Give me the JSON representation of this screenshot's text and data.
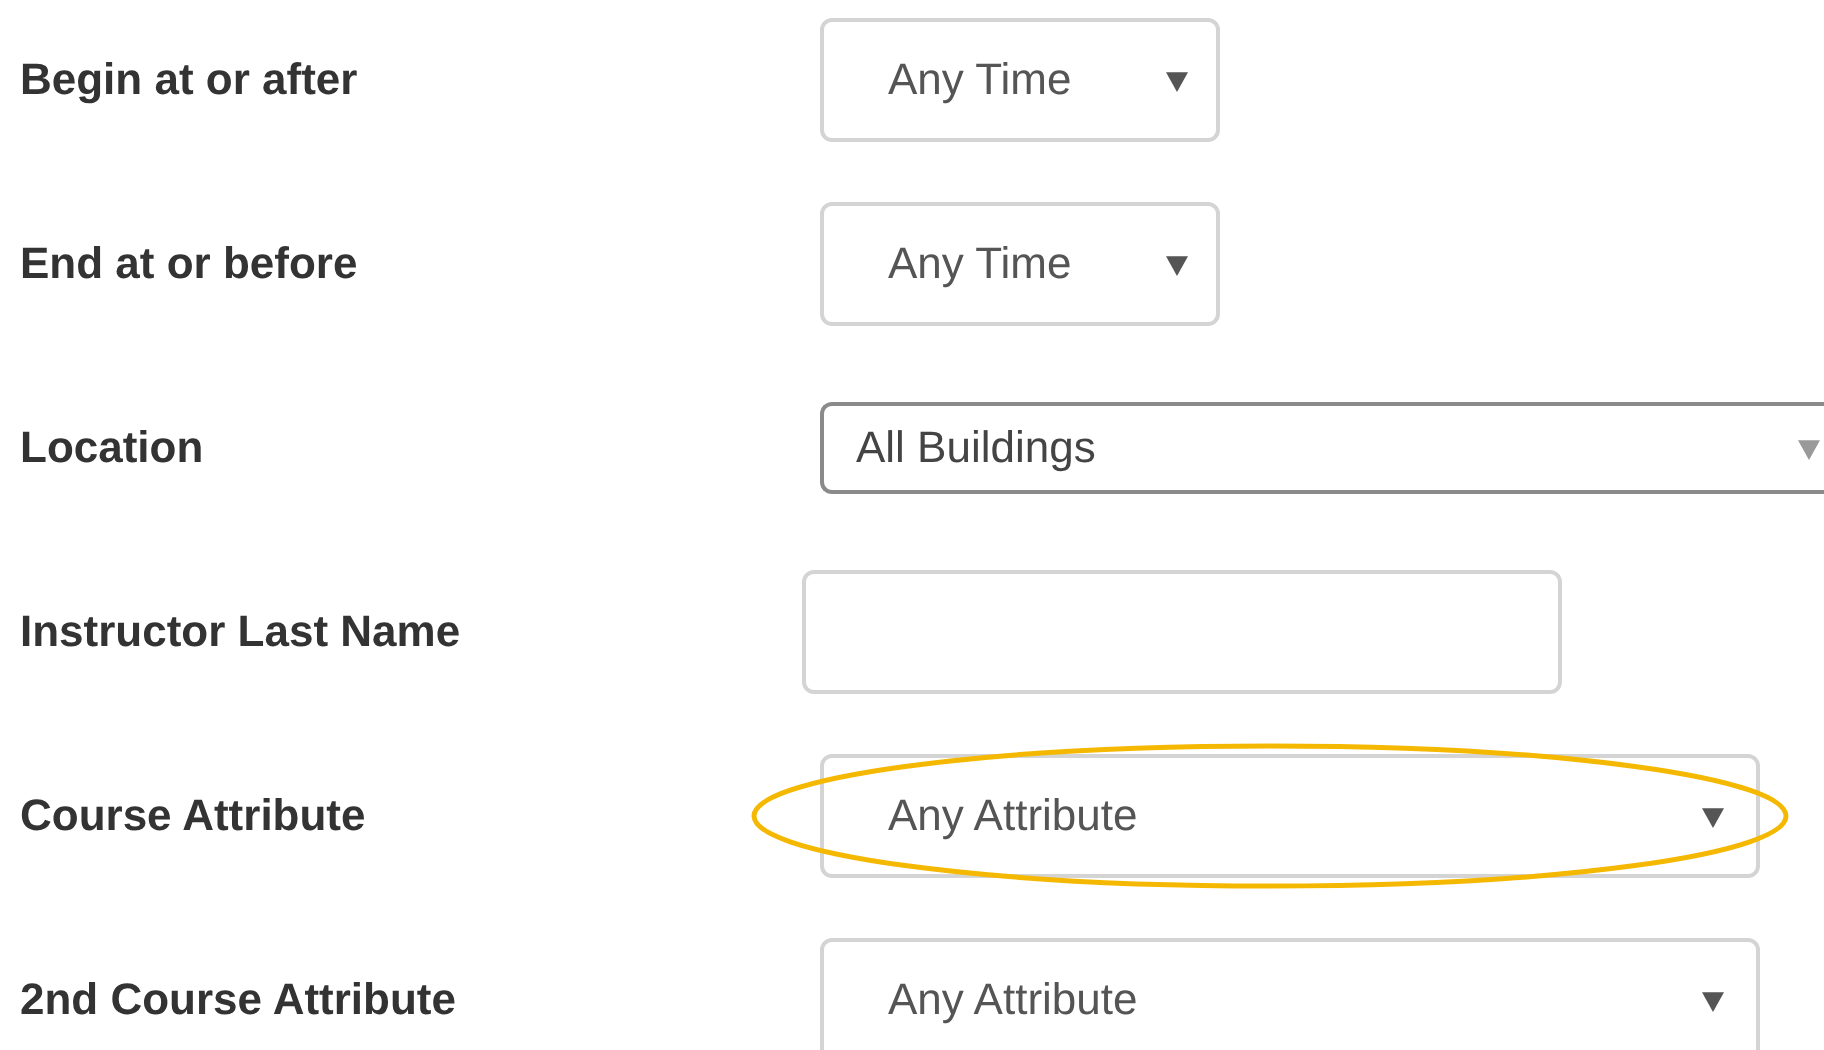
{
  "fields": [
    {
      "label": "Begin at or after",
      "kind": "time-select",
      "value": "Any Time",
      "highlighted": false
    },
    {
      "label": "End at or before",
      "kind": "time-select",
      "value": "Any Time",
      "highlighted": false
    },
    {
      "label": "Location",
      "kind": "building-select",
      "value": "All Buildings",
      "highlighted": false
    },
    {
      "label": "Instructor Last Name",
      "kind": "text-input",
      "highlighted": false
    },
    {
      "label": "Course Attribute",
      "kind": "attribute-select",
      "value": "Any Attribute",
      "highlighted": true
    },
    {
      "label": "2nd Course Attribute",
      "kind": "attribute-select",
      "value": "Any Attribute",
      "highlighted": false
    }
  ]
}
